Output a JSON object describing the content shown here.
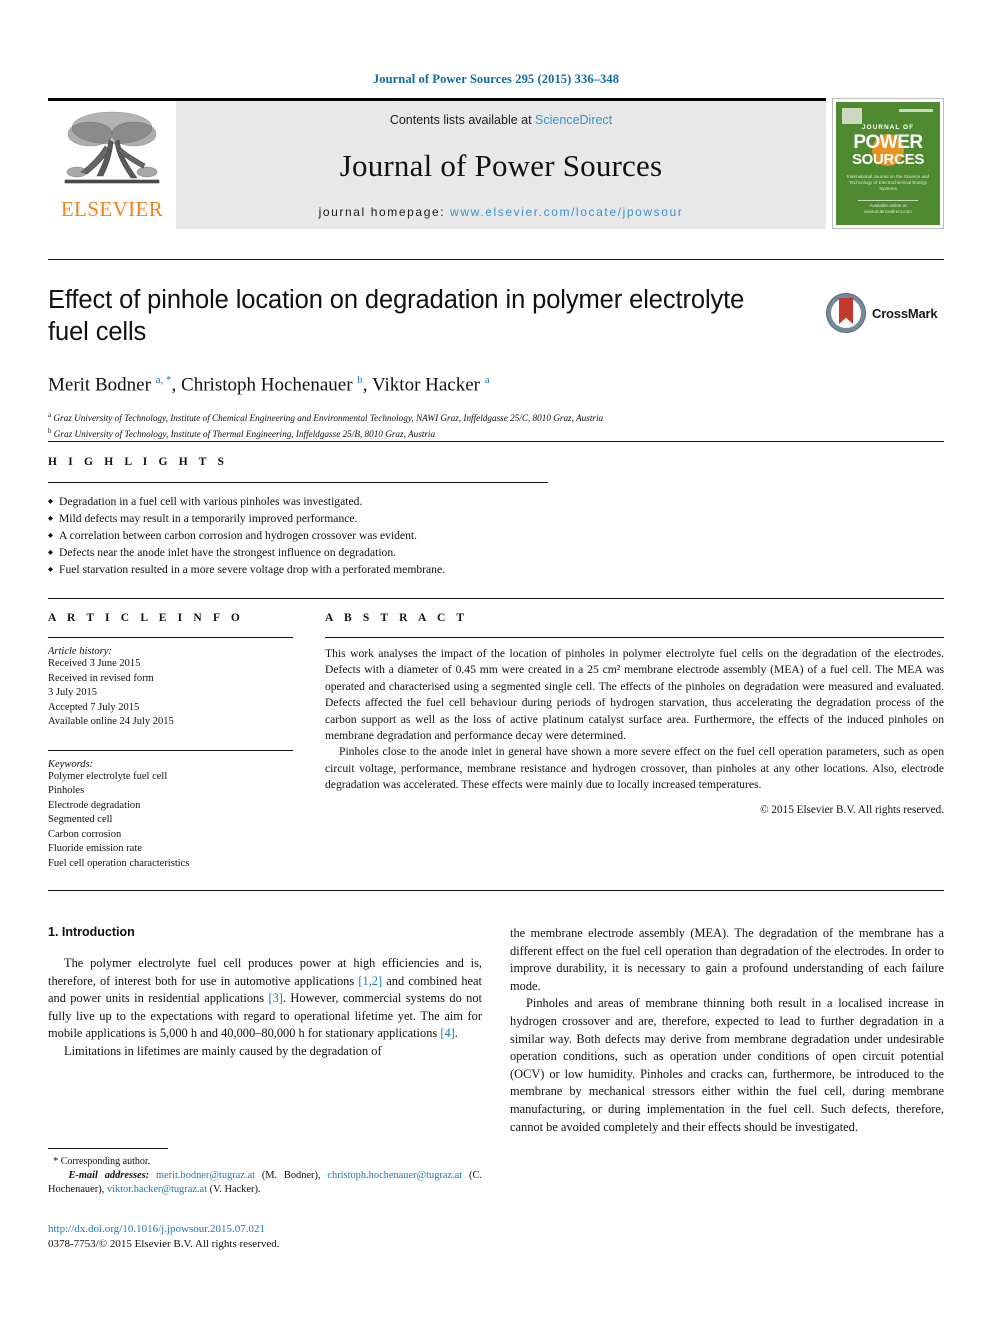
{
  "running_head": "Journal of Power Sources 295 (2015) 336–348",
  "masthead": {
    "contents_prefix": "Contents lists available at ",
    "sciencedirect": "ScienceDirect",
    "journal_name": "Journal of Power Sources",
    "homepage_prefix": "journal homepage: ",
    "homepage_url": "www.elsevier.com/locate/jpowsour",
    "publisher": "ELSEVIER",
    "accent_orange": "#f0821e",
    "link_blue": "#3a92cf"
  },
  "cover": {
    "journal_of": "JOURNAL OF",
    "power": "POWER",
    "sources": "SOURCES",
    "subtitle": "International Journal on the Science and Technology of Electrochemical Energy Systems",
    "footer": "Available online at www.sciencedirect.com",
    "bg_color": "#4f8a30",
    "sun_color": "#e8911f"
  },
  "crossmark": {
    "label": "CrossMark"
  },
  "article": {
    "title": "Effect of pinhole location on degradation in polymer electrolyte fuel cells",
    "authors_html": "Merit Bodner <sup>a, *</sup>, Christoph Hochenauer <sup>b</sup>, Viktor Hacker <sup>a</sup>",
    "affiliation_a": "Graz University of Technology, Institute of Chemical Engineering and Environmental Technology, NAWI Graz, Inffeldgasse 25/C, 8010 Graz, Austria",
    "affiliation_b": "Graz University of Technology, Institute of Thermal Engineering, Inffeldgasse 25/B, 8010 Graz, Austria"
  },
  "highlights": {
    "heading": "H I G H L I G H T S",
    "items": [
      "Degradation in a fuel cell with various pinholes was investigated.",
      "Mild defects may result in a temporarily improved performance.",
      "A correlation between carbon corrosion and hydrogen crossover was evident.",
      "Defects near the anode inlet have the strongest influence on degradation.",
      "Fuel starvation resulted in a more severe voltage drop with a perforated membrane."
    ]
  },
  "article_info": {
    "heading": "A R T I C L E  I N F O",
    "history_label": "Article history:",
    "history": [
      "Received 3 June 2015",
      "Received in revised form",
      "3 July 2015",
      "Accepted 7 July 2015",
      "Available online 24 July 2015"
    ],
    "keywords_label": "Keywords:",
    "keywords": [
      "Polymer electrolyte fuel cell",
      "Pinholes",
      "Electrode degradation",
      "Segmented cell",
      "Carbon corrosion",
      "Fluoride emission rate",
      "Fuel cell operation characteristics"
    ]
  },
  "abstract": {
    "heading": "A B S T R A C T",
    "paragraph_1": "This work analyses the impact of the location of pinholes in polymer electrolyte fuel cells on the degradation of the electrodes. Defects with a diameter of 0.45 mm were created in a 25 cm² membrane electrode assembly (MEA) of a fuel cell. The MEA was operated and characterised using a segmented single cell. The effects of the pinholes on degradation were measured and evaluated. Defects affected the fuel cell behaviour during periods of hydrogen starvation, thus accelerating the degradation process of the carbon support as well as the loss of active platinum catalyst surface area. Furthermore, the effects of the induced pinholes on membrane degradation and performance decay were determined.",
    "paragraph_2": "Pinholes close to the anode inlet in general have shown a more severe effect on the fuel cell operation parameters, such as open circuit voltage, performance, membrane resistance and hydrogen crossover, than pinholes at any other locations. Also, electrode degradation was accelerated. These effects were mainly due to locally increased temperatures.",
    "copyright": "© 2015 Elsevier B.V. All rights reserved."
  },
  "introduction": {
    "heading": "1. Introduction",
    "left_p1_a": "The polymer electrolyte fuel cell produces power at high efficiencies and is, therefore, of interest both for use in automotive applications ",
    "left_p1_ref1": "[1,2]",
    "left_p1_b": " and combined heat and power units in residential applications ",
    "left_p1_ref2": "[3]",
    "left_p1_c": ". However, commercial systems do not fully live up to the expectations with regard to operational lifetime yet. The aim for mobile applications is 5,000 h and 40,000–80,000 h for stationary applications ",
    "left_p1_ref3": "[4]",
    "left_p1_d": ".",
    "left_p2": "Limitations in lifetimes are mainly caused by the degradation of",
    "right_p1": "the membrane electrode assembly (MEA). The degradation of the membrane has a different effect on the fuel cell operation than degradation of the electrodes. In order to improve durability, it is necessary to gain a profound understanding of each failure mode.",
    "right_p2": "Pinholes and areas of membrane thinning both result in a localised increase in hydrogen crossover and are, therefore, expected to lead to further degradation in a similar way. Both defects may derive from membrane degradation under undesirable operation conditions, such as operation under conditions of open circuit potential (OCV) or low humidity. Pinholes and cracks can, furthermore, be introduced to the membrane by mechanical stressors either within the fuel cell, during membrane manufacturing, or during implementation in the fuel cell. Such defects, therefore, cannot be avoided completely and their effects should be investigated."
  },
  "footnotes": {
    "corresponding": "* Corresponding author.",
    "email_label": "E-mail addresses:",
    "email_1": "merit.bodner@tugraz.at",
    "email_1_name": " (M. Bodner), ",
    "email_2": "christoph.hochenauer@tugraz.at",
    "email_2_name": " (C. Hochenauer), ",
    "email_3": "viktor.hacker@tugraz.at",
    "email_3_name": " (V. Hacker)."
  },
  "doi": {
    "url": "http://dx.doi.org/10.1016/j.jpowsour.2015.07.021",
    "issn_line": "0378-7753/© 2015 Elsevier B.V. All rights reserved."
  }
}
